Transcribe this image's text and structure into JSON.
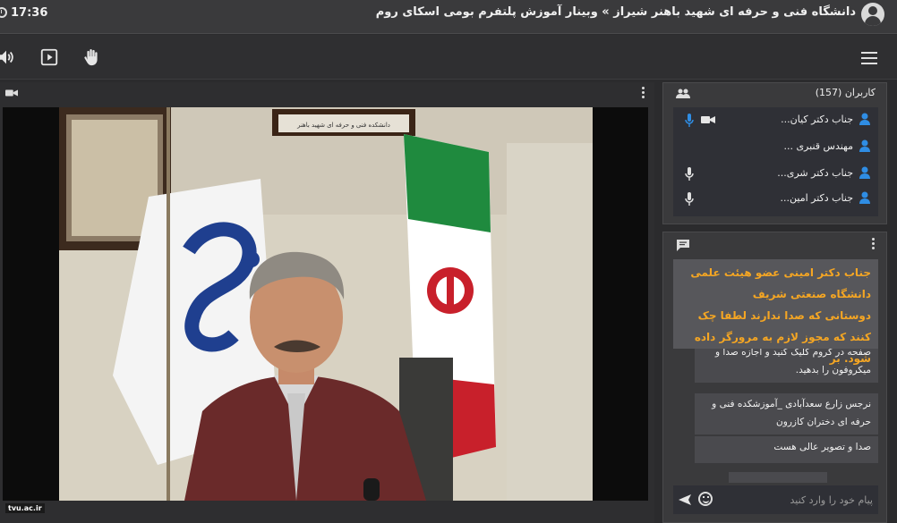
{
  "topbar": {
    "time": "17:36",
    "title": "دانشگاه فنی و حرفه ای شهید باهنر شیراز » وبینار آموزش پلتفرم بومی اسکای روم"
  },
  "toolbar": {
    "audio_icon": "speaker-icon",
    "present_icon": "play-screen-icon",
    "hand_icon": "raise-hand-icon",
    "menu_icon": "hamburger-menu-icon"
  },
  "video": {
    "watermark": "tvu.ac.ir",
    "office_sign": "دانشکده فنی و حرفه ای شهید باهنر"
  },
  "users": {
    "title": "کاربران (157)",
    "list": [
      {
        "name": "جناب دکتر کیان...",
        "mic": true,
        "mic_active": true,
        "cam": true
      },
      {
        "name": "مهندس قنبری ...",
        "mic": false,
        "mic_active": false,
        "cam": false
      },
      {
        "name": "جناب دکتر شری...",
        "mic": true,
        "mic_active": false,
        "cam": false
      },
      {
        "name": "جناب دکتر امین...",
        "mic": true,
        "mic_active": false,
        "cam": false
      }
    ]
  },
  "chat": {
    "notice_line1": "جناب دکتر امینی عضو هیئت علمی دانشگاه صنعتی شریف",
    "notice_line2": "دوستانی که صدا ندارند لطفا چک کنند که مجوز لازم به مرورگر داده شود. بر",
    "msg1": "صفحه در کروم کلیک کنید و اجازه صدا و میکروفون را بدهید.",
    "msg2": "نرجس زارع سعدآبادی _آموزشکده فنی و حرفه ای دختران کازرون",
    "msg3": "صدا و تصویر عالی هست",
    "input_placeholder": "پیام خود را وارد کنید"
  },
  "colors": {
    "accent_blue": "#2f8de4",
    "notice_orange": "#f5a623"
  }
}
